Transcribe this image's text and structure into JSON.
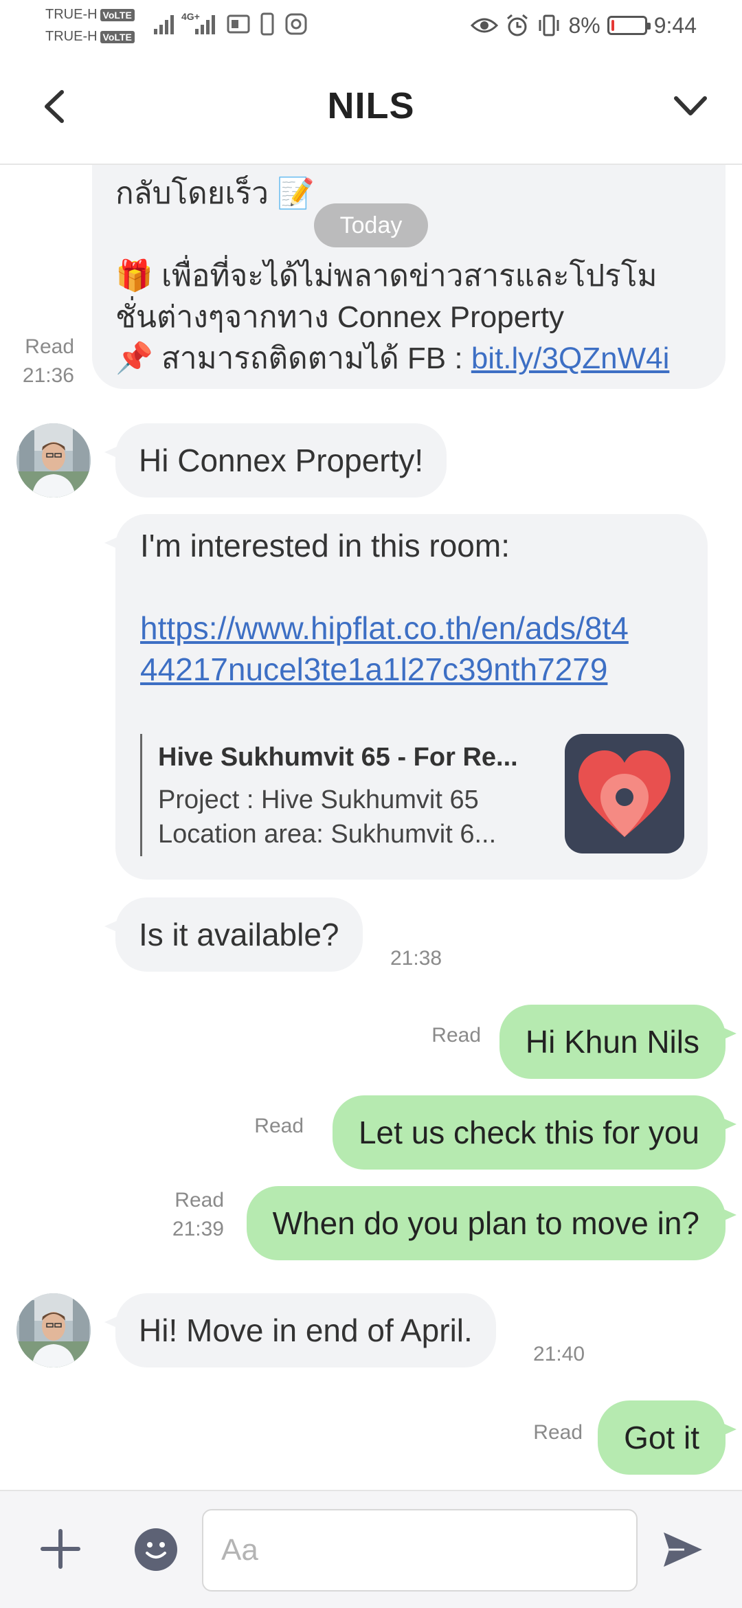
{
  "status_bar": {
    "carrier_1": "TRUE-H",
    "carrier_2": "TRUE-H",
    "volte": "VoLTE",
    "network": "4G+",
    "battery_percent_label": "8%",
    "battery_level": 0.08,
    "time": "9:44",
    "icons": [
      "signal-icon",
      "data-icon",
      "battery-saver-icon",
      "phone-icon",
      "instagram-icon",
      "eye-icon",
      "alarm-icon",
      "vibrate-icon",
      "battery-icon"
    ]
  },
  "header": {
    "title": "NILS",
    "back_icon": "chevron-left-icon",
    "menu_icon": "chevron-down-icon"
  },
  "chat": {
    "date_divider": "Today",
    "first_message": {
      "line1": "กลับโดยเร็ว 📝",
      "line2": "🎁 เพื่อที่จะได้ไม่พลาดข่าวสารและโปรโม",
      "line3": "ชั่นต่างๆจากทาง Connex Property",
      "line4_prefix": "📌 สามารถติดตามได้ FB : ",
      "line4_link": "bit.ly/3QZnW4i",
      "status": "Read",
      "time": "21:36"
    },
    "msg_hi": "Hi Connex Property!",
    "msg_interest": {
      "intro": "I'm interested in this room:",
      "url_line1": "https://www.hipflat.co.th/en/ads/8t4",
      "url_line2": "44217nucel3te1a1l27c39nth7279",
      "preview_title": "Hive Sukhumvit 65 - For Re...",
      "preview_line1": "Project : Hive Sukhumvit 65",
      "preview_line2": "Location area: Sukhumvit 6..."
    },
    "msg_available": {
      "text": "Is it available?",
      "time": "21:38"
    },
    "reply_1": {
      "text": "Hi Khun Nils",
      "status": "Read"
    },
    "reply_2": {
      "text": "Let us check this for you",
      "status": "Read"
    },
    "reply_3": {
      "text": "When do you plan to move in?",
      "status": "Read",
      "time": "21:39"
    },
    "msg_move": {
      "text": "Hi! Move in end of April.",
      "time": "21:40"
    },
    "reply_4": {
      "text": "Got it",
      "status": "Read"
    }
  },
  "input_bar": {
    "placeholder": "Aa",
    "icons": [
      "plus-icon",
      "emoji-icon",
      "send-icon"
    ]
  },
  "colors": {
    "incoming_bubble": "#f2f3f5",
    "outgoing_bubble": "#b6eab0",
    "link": "#3d6fc4"
  }
}
